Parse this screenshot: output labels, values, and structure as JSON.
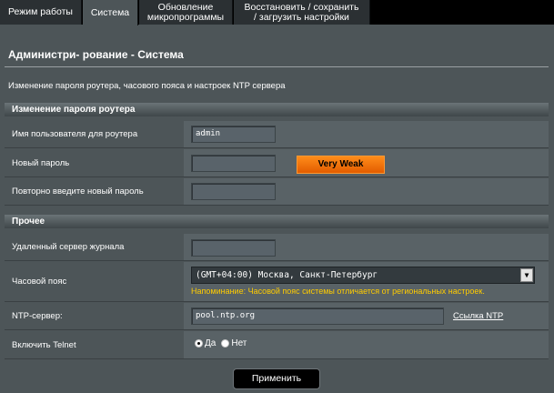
{
  "tabs": [
    {
      "label": "Режим работы",
      "active": false
    },
    {
      "label": "Система",
      "active": true
    },
    {
      "label_line1": "Обновление",
      "label_line2": "микропрограммы",
      "active": false
    },
    {
      "label_line1": "Восстановить / сохранить",
      "label_line2": "/ загрузить настройки",
      "active": false
    }
  ],
  "page": {
    "title": "Администри- рование - Система",
    "description": "Изменение пароля роутера, часового пояса и настроек NTP сервера"
  },
  "password_section": {
    "header": "Изменение пароля роутера",
    "username_label": "Имя пользователя для роутера",
    "username_value": "admin",
    "new_password_label": "Новый пароль",
    "new_password_value": "",
    "strength_text": "Very Weak",
    "repeat_password_label": "Повторно введите новый пароль",
    "repeat_password_value": ""
  },
  "misc_section": {
    "header": "Прочее",
    "log_server_label": "Удаленный сервер журнала",
    "log_server_value": "",
    "timezone_label": "Часовой пояс",
    "timezone_value": "(GMT+04:00) Москва, Санкт-Петербург",
    "timezone_reminder": "Напоминание: Часовой пояс системы отличается от региональных настроек.",
    "ntp_label": "NTP-сервер:",
    "ntp_value": "pool.ntp.org",
    "ntp_link": "Ссылка NTP",
    "telnet_label": "Включить Telnet",
    "telnet_yes": "Да",
    "telnet_no": "Нет",
    "telnet_selected": "yes"
  },
  "apply_label": "Применить",
  "colors": {
    "background": "#4d5558",
    "strength_bar": "#ff8c1a",
    "reminder_text": "#ffcc00"
  }
}
